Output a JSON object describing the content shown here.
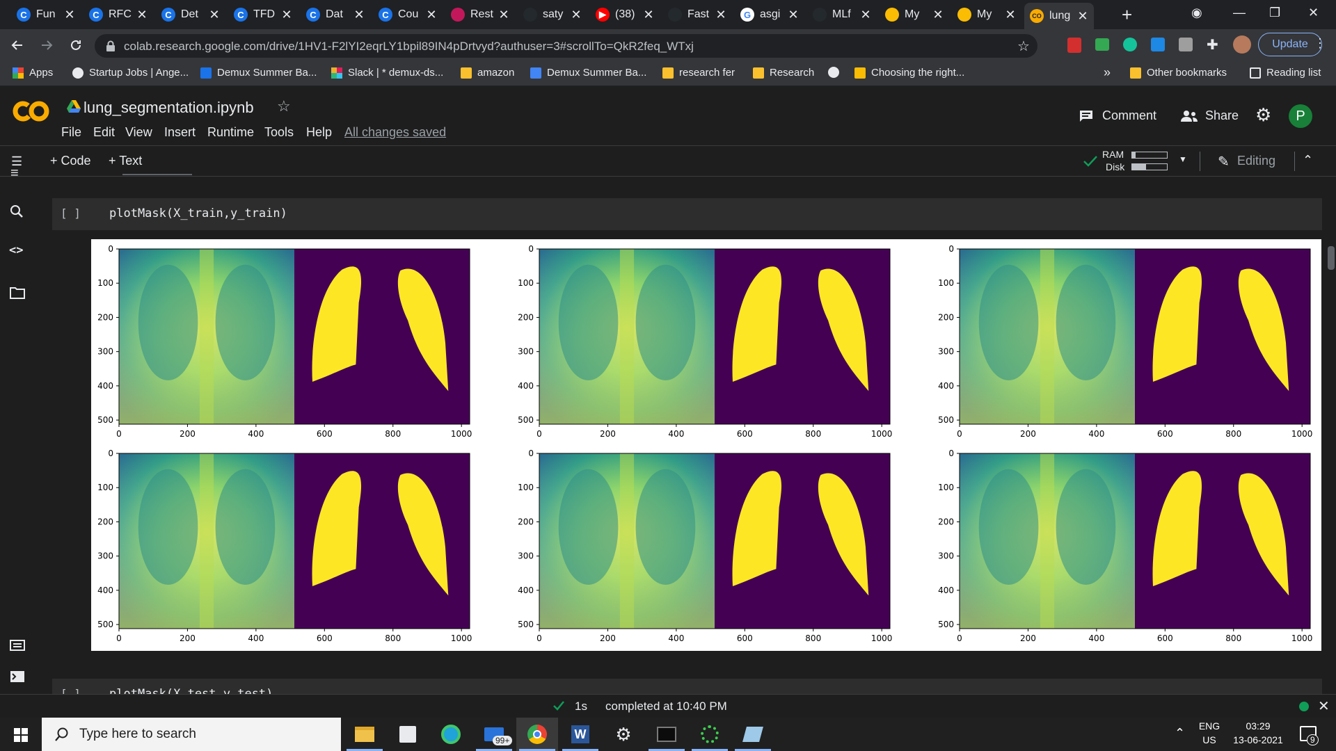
{
  "browser": {
    "tabs": [
      {
        "title": "Fun",
        "icon": "colab-c",
        "color": "#1a73e8"
      },
      {
        "title": "RFC",
        "icon": "colab-c",
        "color": "#1a73e8"
      },
      {
        "title": "Det",
        "icon": "colab-c",
        "color": "#1a73e8"
      },
      {
        "title": "TFD",
        "icon": "colab-c",
        "color": "#1a73e8"
      },
      {
        "title": "Dat",
        "icon": "colab-c",
        "color": "#1a73e8"
      },
      {
        "title": "Cou",
        "icon": "colab-c",
        "color": "#1a73e8"
      },
      {
        "title": "Rest",
        "icon": "pink-app",
        "color": "#c2185b"
      },
      {
        "title": "saty",
        "icon": "github",
        "color": "#24292e"
      },
      {
        "title": "(38)",
        "icon": "youtube",
        "color": "#ff0000"
      },
      {
        "title": "Fast",
        "icon": "github",
        "color": "#24292e"
      },
      {
        "title": "asgi",
        "icon": "google-g",
        "color": "#ffffff"
      },
      {
        "title": "MLf",
        "icon": "github",
        "color": "#24292e"
      },
      {
        "title": "My",
        "icon": "drive",
        "color": "#fbbc04"
      },
      {
        "title": "My",
        "icon": "drive",
        "color": "#fbbc04"
      },
      {
        "title": "lung",
        "icon": "colab-co",
        "color": "#f9ab00",
        "active": true
      }
    ],
    "new_tab": "+",
    "url": "colab.research.google.com/drive/1HV1-F2lYI2eqrLY1bpil89IN4pDrtvyd?authuser=3#scrollTo=QkR2feq_WTxj",
    "update_label": "Update",
    "bookmarks": [
      {
        "label": "Apps",
        "icon": "apps-grid"
      },
      {
        "label": "Startup Jobs | Ange...",
        "icon": "angel-hand"
      },
      {
        "label": "Demux Summer Ba...",
        "icon": "v-logo"
      },
      {
        "label": "Slack | * demux-ds...",
        "icon": "slack"
      },
      {
        "label": "amazon",
        "icon": "folder"
      },
      {
        "label": "Demux Summer Ba...",
        "icon": "docs"
      },
      {
        "label": "research fer",
        "icon": "folder"
      },
      {
        "label": "Research",
        "icon": "folder"
      },
      {
        "label": "",
        "icon": "globe"
      },
      {
        "label": "Choosing the right...",
        "icon": "page"
      }
    ],
    "more_bookmarks": "»",
    "other_bookmarks": "Other bookmarks",
    "reading_list": "Reading list"
  },
  "colab": {
    "filename": "lung_segmentation.ipynb",
    "menu": [
      "File",
      "Edit",
      "View",
      "Insert",
      "Runtime",
      "Tools",
      "Help"
    ],
    "save_status": "All changes saved",
    "comment_label": "Comment",
    "share_label": "Share",
    "avatar_letter": "P",
    "add_code": "+ Code",
    "add_text": "+ Text",
    "ram_label": "RAM",
    "disk_label": "Disk",
    "ram_usage": 0.1,
    "disk_usage": 0.4,
    "editing_label": "Editing",
    "cells": [
      {
        "bracket": "[ ]",
        "code": "plotMask(X_train,y_train)"
      },
      {
        "bracket": "[ ]",
        "code": "plotMask(X_test,y_test)"
      }
    ],
    "status_time": "1s",
    "status_text": "completed at 10:40 PM"
  },
  "chart_data": {
    "type": "image-grid",
    "panels": 6,
    "layout": "2 rows x 3 columns",
    "xlim": [
      0,
      1024
    ],
    "ylim": [
      512,
      0
    ],
    "x_ticks": [
      0,
      200,
      400,
      600,
      800,
      1000
    ],
    "y_ticks": [
      0,
      100,
      200,
      300,
      400,
      500
    ],
    "colormap": "viridis",
    "colors": {
      "mask": "#fde725",
      "background": "#440154",
      "xray_mid": "#3aa87a",
      "xray_light": "#c9e04a"
    }
  },
  "taskbar": {
    "search_placeholder": "Type here to search",
    "badge": "99+",
    "lang_top": "ENG",
    "lang_bottom": "US",
    "time": "03:29",
    "date": "13-06-2021",
    "notification_count": "9"
  }
}
